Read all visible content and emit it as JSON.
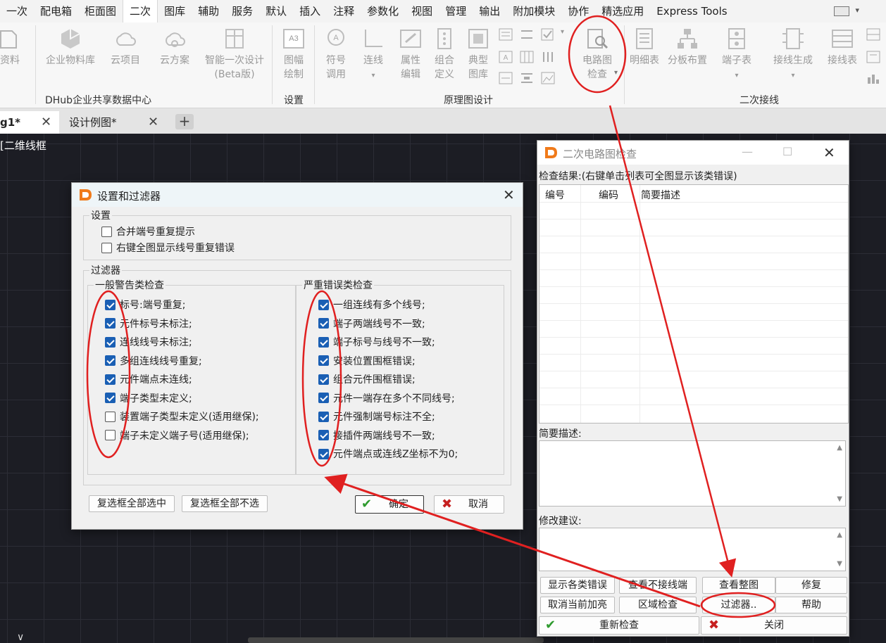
{
  "ribbon_tabs": [
    "一次",
    "配电箱",
    "柜面图",
    "二次",
    "图库",
    "辅助",
    "服务",
    "默认",
    "插入",
    "注释",
    "参数化",
    "视图",
    "管理",
    "输出",
    "附加模块",
    "协作",
    "精选应用",
    "Express Tools"
  ],
  "active_tab": "二次",
  "ribbon": {
    "buttons": {
      "ziliao": "资料",
      "enterprise_lib": "企业物料库",
      "cloud_project": "云项目",
      "cloud_plan": "云方案",
      "smart_design_1": "智能一次设计",
      "smart_design_2": "(Beta版)",
      "frame_draw_1": "图幅",
      "frame_draw_2": "绘制",
      "symbol_1": "符号",
      "symbol_2": "调用",
      "wire": "连线",
      "attr_1": "属性",
      "attr_2": "编辑",
      "combo_1": "组合",
      "combo_2": "定义",
      "typical_1": "典型",
      "typical_2": "图库",
      "circuit_check_1": "电路图",
      "circuit_check_2": "检查",
      "detail_table": "明细表",
      "panel_layout": "分板布置",
      "terminal_table": "端子表",
      "wiring_gen": "接线生成",
      "wiring_table": "接线表"
    },
    "groups": {
      "dhub": "DHub企业共享数据中心",
      "settings": "设置",
      "schematic": "原理图设计",
      "secondary_wiring": "二次接线"
    },
    "frame_icon_text": "A3"
  },
  "doc_tabs": [
    {
      "label": "g1*"
    },
    {
      "label": "设计例图*"
    }
  ],
  "canvas_label": "[二维线框",
  "settings_dialog": {
    "title": "设置和过滤器",
    "settings_legend": "设置",
    "settings_options": [
      {
        "label": "合并端号重复提示",
        "checked": false
      },
      {
        "label": "右键全图显示线号重复错误",
        "checked": false
      }
    ],
    "filter_legend": "过滤器",
    "general_legend": "一般警告类检查",
    "general_items": [
      {
        "label": "标号:端号重复;",
        "checked": true
      },
      {
        "label": "元件标号未标注;",
        "checked": true
      },
      {
        "label": "连线线号未标注;",
        "checked": true
      },
      {
        "label": "多组连线线号重复;",
        "checked": true
      },
      {
        "label": "元件端点未连线;",
        "checked": true
      },
      {
        "label": "端子类型未定义;",
        "checked": true
      },
      {
        "label": "装置端子类型未定义(适用继保);",
        "checked": false
      },
      {
        "label": "端子未定义端子号(适用继保);",
        "checked": false
      }
    ],
    "severe_legend": "严重错误类检查",
    "severe_items": [
      {
        "label": "一组连线有多个线号;",
        "checked": true
      },
      {
        "label": "端子两端线号不一致;",
        "checked": true
      },
      {
        "label": "端子标号与线号不一致;",
        "checked": true
      },
      {
        "label": "安装位置围框错误;",
        "checked": true
      },
      {
        "label": "组合元件围框错误;",
        "checked": true
      },
      {
        "label": "元件一端存在多个不同线号;",
        "checked": true
      },
      {
        "label": "元件强制端号标注不全;",
        "checked": true
      },
      {
        "label": "接插件两端线号不一致;",
        "checked": true
      },
      {
        "label": "元件端点或连线Z坐标不为0;",
        "checked": true
      }
    ],
    "select_all": "复选框全部选中",
    "deselect_all": "复选框全部不选",
    "ok": "确定",
    "cancel": "取消"
  },
  "check_dialog": {
    "title": "二次电路图检查",
    "results_label": "检查结果:(右键单击列表可全图显示该类错误)",
    "columns": [
      "编号",
      "编码",
      "简要描述"
    ],
    "summary_label": "简要描述:",
    "suggestion_label": "修改建议:",
    "buttons": {
      "show_errors": "显示各类错误",
      "view_unconnected": "查看不接线端",
      "view_full": "查看整图",
      "repair": "修复",
      "cancel_highlight": "取消当前加亮",
      "area_check": "区域检查",
      "filter": "过滤器..",
      "help": "帮助",
      "recheck": "重新检查",
      "close": "关闭"
    }
  },
  "colors": {
    "annotation_red": "#e02020",
    "checkbox_blue": "#1a5fb4",
    "canvas_bg": "#1c1d24"
  }
}
